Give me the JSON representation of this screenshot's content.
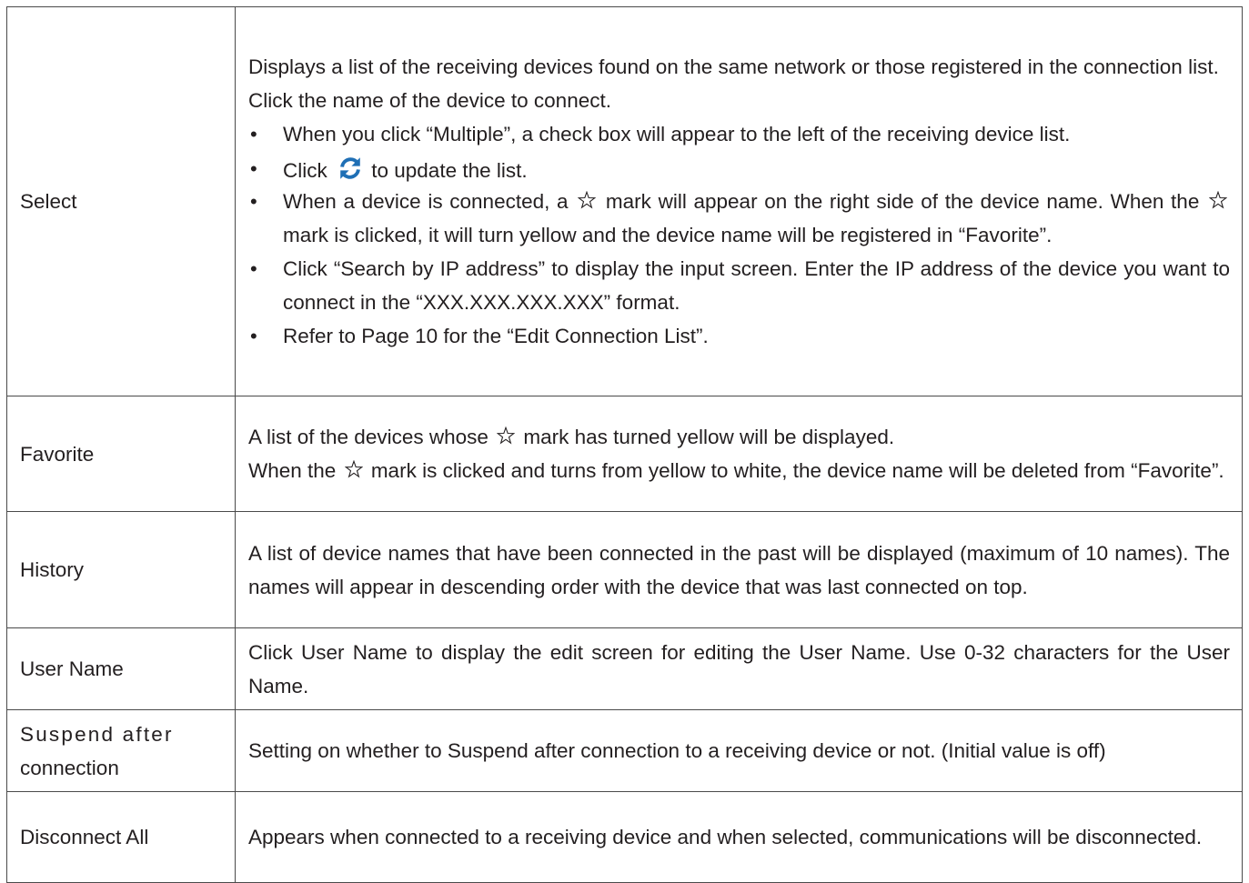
{
  "rows": [
    {
      "label": "Select",
      "intro_1": "Displays a list of the receiving devices found on the same network or those registered in the connection list.",
      "intro_2": "Click the name of the device to connect.",
      "bullet_1": "When you click “Multiple”, a check box will appear to the left of the receiving device list.",
      "bullet_2_before": "Click",
      "bullet_2_after": "to update the list.",
      "bullet_3_part1": "When a device is connected, a",
      "bullet_3_part2": "mark will appear on the right side of the device name. When the",
      "bullet_3_part3": "mark is clicked, it will turn yellow and the device name will be registered in “Favorite”.",
      "bullet_4": "Click “Search by IP address” to display the input screen. Enter the IP address of the device you want to connect in the “XXX.XXX.XXX.XXX” format.",
      "bullet_5": "Refer to Page 10 for the “Edit Connection List”."
    },
    {
      "label": "Favorite",
      "line_1_before": "A list of the devices whose",
      "line_1_after": "mark has turned yellow will be displayed.",
      "line_2_before": "When the",
      "line_2_after": "mark is clicked and turns from yellow to white, the device name will be deleted from “Favorite”."
    },
    {
      "label": "History",
      "text": "A list of device names that have been connected in the past will be displayed (maximum of 10 names). The names will appear in descending order with the device that was last connected on top."
    },
    {
      "label": "User Name",
      "text": "Click User Name to display the edit screen for editing the User Name. Use 0-32 characters for the User Name."
    },
    {
      "label_line_1": "Suspend after",
      "label_line_2": "connection",
      "text": "Setting on whether to Suspend after connection to a receiving device or not. (Initial value is off)"
    },
    {
      "label": "Disconnect All",
      "text": "Appears when connected to a receiving device and when selected, communications will be disconnected."
    }
  ],
  "icons": {
    "refresh": "refresh-icon",
    "star": "star-outline-icon",
    "refresh_color": "#1f6fb5",
    "star_color": "#231f20"
  }
}
